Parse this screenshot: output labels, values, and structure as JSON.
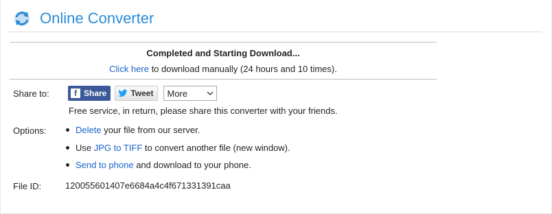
{
  "brand": {
    "name": "Online Converter",
    "icon": "refresh-arrows-icon",
    "color": "#2a8bd6"
  },
  "status": {
    "title": "Completed and Starting Download...",
    "link_text": "Click here",
    "rest_text": " to download manually (24 hours and 10 times)."
  },
  "share": {
    "label": "Share to:",
    "facebook_label": "Share",
    "twitter_label": "Tweet",
    "more_selected": "More",
    "note": "Free service, in return, please share this converter with your friends."
  },
  "options": {
    "label": "Options:",
    "items": [
      {
        "link": "Delete",
        "pre": "",
        "post": " your file from our server."
      },
      {
        "link": "JPG to TIFF",
        "pre": "Use ",
        "post": " to convert another file (new window)."
      },
      {
        "link": "Send to phone",
        "pre": "",
        "post": " and download to your phone."
      }
    ]
  },
  "file": {
    "label": "File ID:",
    "value": "120055601407e6684a4c4f671331391caa"
  },
  "colors": {
    "link": "#1a63c7",
    "facebook": "#3b5998"
  }
}
